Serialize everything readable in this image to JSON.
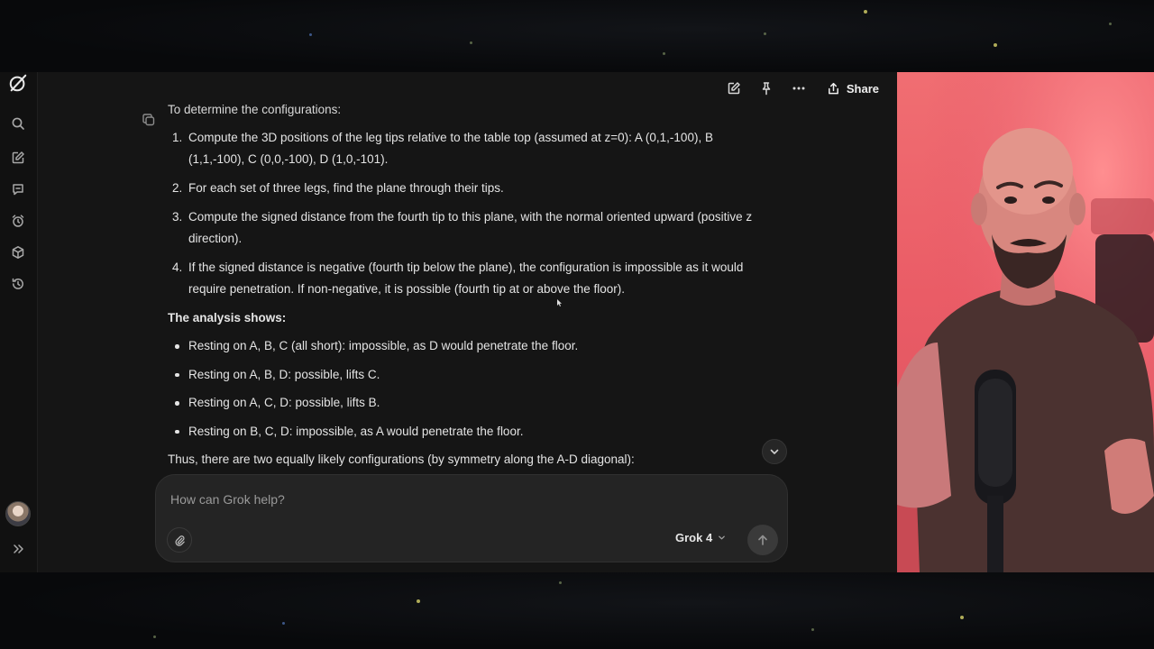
{
  "topbar": {
    "share_label": "Share"
  },
  "message": {
    "intro": "To determine the configurations:",
    "steps": [
      {
        "num": "1.",
        "text": "Compute the 3D positions of the leg tips relative to the table top (assumed at z=0): A (0,1,-100), B (1,1,-100), C (0,0,-100), D (1,0,-101)."
      },
      {
        "num": "2.",
        "text": "For each set of three legs, find the plane through their tips."
      },
      {
        "num": "3.",
        "text": "Compute the signed distance from the fourth tip to this plane, with the normal oriented upward (positive z direction)."
      },
      {
        "num": "4.",
        "text": "If the signed distance is negative (fourth tip below the plane), the configuration is impossible as it would require penetration. If non-negative, it is possible (fourth tip at or above the floor)."
      }
    ],
    "analysis_heading": "The analysis shows:",
    "results": [
      "Resting on A, B, C (all short): impossible, as D would penetrate the floor.",
      "Resting on A, B, D: possible, lifts C.",
      "Resting on A, C, D: possible, lifts B.",
      "Resting on B, C, D: impossible, as A would penetrate the floor."
    ],
    "conclusion": "Thus, there are two equally likely configurations (by symmetry along the A-D diagonal):"
  },
  "composer": {
    "placeholder": "How can Grok help?",
    "model": "Grok 4"
  },
  "colors": {
    "app_background": "#151515",
    "sidebar_background": "#111111",
    "composer_background": "#242424",
    "webcam_background": "#ea5c66"
  },
  "icons": {
    "sidebar": [
      "grok-logo-icon",
      "search-icon",
      "new-chat-icon",
      "chat-bubble-icon",
      "alarm-icon",
      "cube-icon",
      "history-icon",
      "expand-chevrons-icon"
    ],
    "topbar": [
      "edit-icon",
      "pin-icon",
      "more-icon",
      "share-icon"
    ],
    "composer": [
      "paperclip-icon",
      "chevron-down-icon",
      "arrow-up-icon"
    ]
  }
}
